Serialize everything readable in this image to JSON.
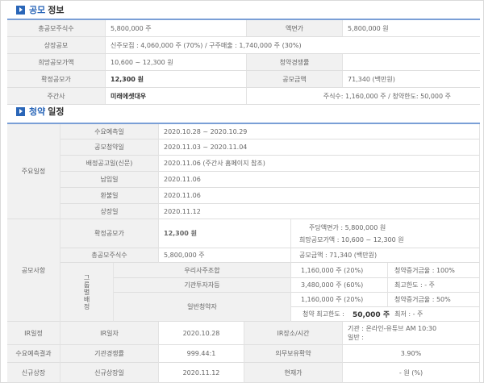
{
  "section1": {
    "title_blue": "공모",
    "title_dark": "정보"
  },
  "info": {
    "r1": {
      "l1": "총공모주식수",
      "v1": "5,800,000 주",
      "l2": "액면가",
      "v2": "5,800,000 원"
    },
    "r2": {
      "l1": "상장공모",
      "v1": "신주모집 : 4,060,000 주 (70%)   /   구주매출 : 1,740,000 주 (30%)"
    },
    "r3": {
      "l1": "희망공모가액",
      "v1": "10,600 ~ 12,300 원",
      "l2": "청약경쟁률",
      "v2": ""
    },
    "r4": {
      "l1": "확정공모가",
      "v1": "12,300 원",
      "l2": "공모금액",
      "v2": "71,340 (백만원)"
    },
    "r5": {
      "l1": "주간사",
      "v1": "미래에셋대우",
      "v2": "주식수: 1,160,000 주   /   청약한도: 50,000 주"
    }
  },
  "section2": {
    "title_blue": "청약",
    "title_dark": "일정"
  },
  "schedule": {
    "main_label": "주요일정",
    "rows": [
      {
        "label": "수요예측일",
        "value": "2020.10.28   ~   2020.10.29"
      },
      {
        "label": "공모청약일",
        "value": "2020.11.03   ~   2020.11.04"
      },
      {
        "label": "배정공고일(신문)",
        "value": "2020.11.06 (주간사 홈페이지 참조)"
      },
      {
        "label": "납입일",
        "value": "2020.11.06"
      },
      {
        "label": "환불일",
        "value": "2020.11.06"
      },
      {
        "label": "상장일",
        "value": "2020.11.12"
      }
    ],
    "offering_label": "공모사항",
    "fixed_price_label": "확정공모가",
    "fixed_price_value": "12,300 원",
    "par_value": "주당액면가 :   5,800,000 원",
    "hope_price": "희망공모가액 :   10,600 ~ 12,300 원",
    "total_shares_label": "총공모주식수",
    "total_shares_value": "5,800,000 주",
    "amount": "공모금액 :   71,340 (백만원)",
    "alloc_label": "그룹별배정",
    "alloc": [
      {
        "group": "우리사주조합",
        "shares": "1,160,000 주   (20%)",
        "note": "청약증거금율 : 100%"
      },
      {
        "group": "기관투자자등",
        "shares": "3,480,000 주   (60%)",
        "note": "최고한도 :  - 주"
      },
      {
        "group": "일반청약자",
        "shares": "1,160,000 주   (20%)",
        "note": "청약증거금율 : 50%"
      }
    ],
    "limit_prefix": "청약 최고한도 :",
    "limit_value": "50,000 주",
    "limit_suffix": "최저 :  - 주",
    "ir_label": "IR일정",
    "ir_date_label": "IR일자",
    "ir_date": "2020.10.28",
    "ir_place_label": "IR장소/시간",
    "ir_place_1": "기관 : 온라인-유튜브 AM 10:30",
    "ir_place_2": "일반 :",
    "demand_label": "수요예측결과",
    "competition_label": "기관경쟁률",
    "competition_value": "999.44:1",
    "lockup_label": "의무보유확약",
    "lockup_value": "3.90%",
    "listing_label": "신규상장",
    "listing_date_label": "신규상장일",
    "listing_date": "2020.11.12",
    "current_price_label": "현재가",
    "current_price_value": "- 원 (%)"
  }
}
